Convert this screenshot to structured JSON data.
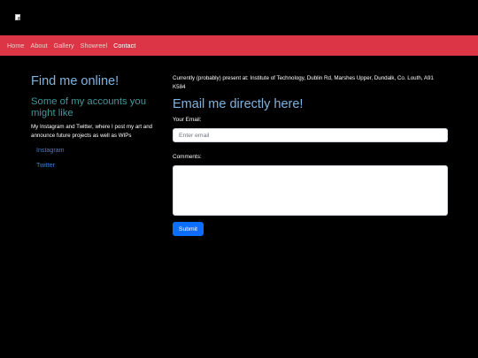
{
  "logo": {
    "icon": "broken-image-icon"
  },
  "nav": {
    "color": "#dc3545",
    "items": [
      {
        "label": "Home"
      },
      {
        "label": "About"
      },
      {
        "label": "Gallery"
      },
      {
        "label": "Showreel"
      },
      {
        "label": "Contact",
        "active": true
      }
    ]
  },
  "left": {
    "title": "Find me online!",
    "subtitle": "Some of my accounts you might like",
    "description": "My Instagram and Twitter, where I post my art and announce future projects as well as WIPs",
    "links": [
      {
        "label": "Instagram"
      },
      {
        "label": "Twitter"
      }
    ]
  },
  "right": {
    "location": "Currently (probably) present at: Institute of Technology, Dublin Rd, Marshes Upper, Dundalk, Co. Louth, A91 K584",
    "title": "Email me directly here!",
    "email_label": "Your Email:",
    "email_placeholder": "Enter email",
    "email_value": "",
    "comments_label": "Comments:",
    "comments_value": "",
    "submit_label": "Submit",
    "submit_color": "#0d6efd"
  }
}
